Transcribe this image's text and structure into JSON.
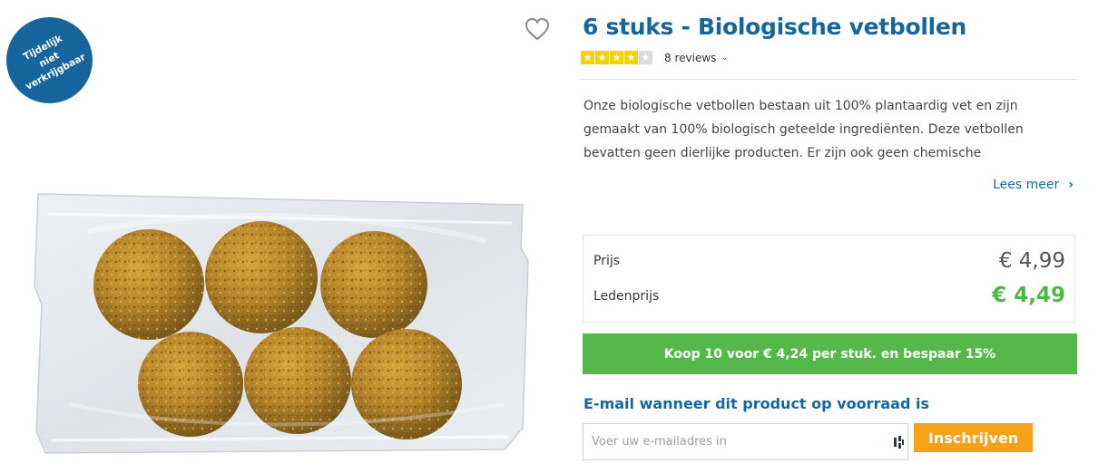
{
  "badge": {
    "text": "Tijdelijk\nniet verkrijgbaar"
  },
  "favorite": {
    "icon": "heart-outline-icon"
  },
  "product": {
    "title": "6 stuks - Biologische vetbollen",
    "rating": {
      "stars_filled": 4,
      "stars_total": 5,
      "reviews_label": "8 reviews",
      "star_color": "#f3d200"
    },
    "description": "Onze biologische vetbollen bestaan uit 100% plantaardig vet en zijn gemaakt van 100% biologisch geteelde ingrediënten. Deze vetbollen bevatten geen dierlijke producten. Er zijn ook geen chemische",
    "read_more": "Lees meer"
  },
  "pricing": {
    "regular_label": "Prijs",
    "regular_price": "€ 4,99",
    "member_label": "Ledenprijs",
    "member_price": "€ 4,49",
    "member_color": "#4cb848"
  },
  "bulk_offer": {
    "text": "Koop 10 voor € 4,24 per stuk. en bespaar 15%",
    "color": "#55b84a"
  },
  "notify": {
    "heading": "E-mail wanneer dit product op voorraad is",
    "email_placeholder": "Voer uw e-mailadres in",
    "email_value": "",
    "subscribe_label": "Inschrijven",
    "button_color": "#f7a11a"
  },
  "colors": {
    "brand_blue": "#17659d"
  }
}
